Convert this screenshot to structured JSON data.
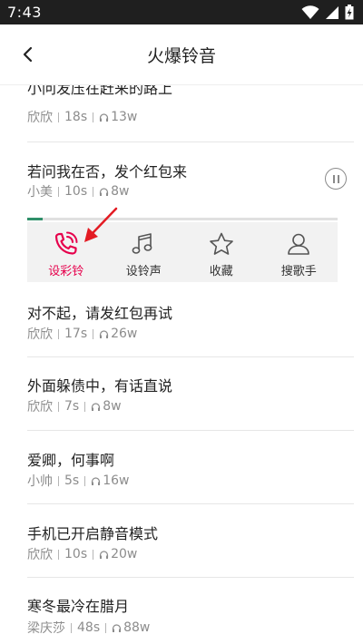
{
  "status_bar": {
    "time": "7:43"
  },
  "header": {
    "title": "火爆铃音"
  },
  "playing_progress": 0.05,
  "rows": [
    {
      "title": "小问发压在赶来的路上",
      "artist": "欣欣",
      "duration": "18s",
      "plays": "13w"
    },
    {
      "title": "若问我在否，发个红包来",
      "artist": "小美",
      "duration": "10s",
      "plays": "8w"
    },
    {
      "title": "对不起，请发红包再试",
      "artist": "欣欣",
      "duration": "17s",
      "plays": "26w"
    },
    {
      "title": "外面躲债中，有话直说",
      "artist": "欣欣",
      "duration": "7s",
      "plays": "8w"
    },
    {
      "title": "爱卿，何事啊",
      "artist": "小帅",
      "duration": "5s",
      "plays": "16w"
    },
    {
      "title": "手机已开启静音模式",
      "artist": "欣欣",
      "duration": "10s",
      "plays": "20w"
    },
    {
      "title": "寒冬最冷在腊月",
      "artist": "梁庆莎",
      "duration": "48s",
      "plays": "88w"
    }
  ],
  "actions": [
    {
      "label": "设彩铃",
      "icon": "phone-ring-icon"
    },
    {
      "label": "设铃声",
      "icon": "music-note-icon"
    },
    {
      "label": "收藏",
      "icon": "star-icon"
    },
    {
      "label": "搜歌手",
      "icon": "singer-icon"
    }
  ],
  "colors": {
    "accent": "#e6004c",
    "progress": "#2f8f6a",
    "arrow": "#e31b23"
  }
}
